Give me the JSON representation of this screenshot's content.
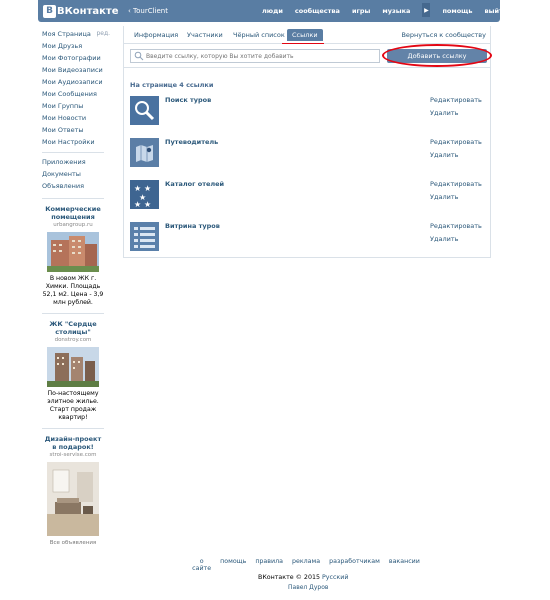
{
  "topbar": {
    "logo_text": "ВКонтакте",
    "logo_letter": "В",
    "back_label": "‹ TourClient",
    "nav": [
      "люди",
      "сообщества",
      "игры",
      "музыка",
      "помощь",
      "выйти"
    ],
    "colors": {
      "bar": "#597da3",
      "link": "#2b587a"
    }
  },
  "sidebar": {
    "edit_label": "ред.",
    "items": [
      "Моя Страница",
      "Мои Друзья",
      "Мои Фотографии",
      "Мои Видеозаписи",
      "Мои Аудиозаписи",
      "Мои Сообщения",
      "Мои Группы",
      "Мои Новости",
      "Мои Ответы",
      "Мои Настройки"
    ],
    "extra": [
      "Приложения",
      "Документы",
      "Объявления"
    ],
    "ads": [
      {
        "title": "Коммерческие помещения",
        "domain": "urbangroup.ru",
        "text": "В новом ЖК г. Химки. Площадь 52,1 м2. Цена - 3,9 млн рублей."
      },
      {
        "title": "ЖК \"Сердце столицы\"",
        "domain": "donstroy.com",
        "text": "По-настоящему элитное жилье. Старт продаж квартир!"
      },
      {
        "title": "Дизайн-проект в подарок!",
        "domain": "stroi-servise.com",
        "text": ""
      }
    ],
    "all_ads": "Все объявления"
  },
  "tabs": {
    "items": [
      "Информация",
      "Участники",
      "Чёрный список",
      "Ссылки"
    ],
    "active": "Ссылки",
    "return_label": "Вернуться к сообществу"
  },
  "search": {
    "placeholder": "Введите ссылку, которую Вы хотите добавить",
    "add_label": "Добавить ссылку"
  },
  "links": {
    "count_label": "На странице 4 ссылки",
    "edit_label": "Редактировать",
    "delete_label": "Удалить",
    "items": [
      {
        "title": "Поиск туров",
        "icon": "magnifier-icon"
      },
      {
        "title": "Путеводитель",
        "icon": "map-icon"
      },
      {
        "title": "Каталог отелей",
        "icon": "stars-icon"
      },
      {
        "title": "Витрина туров",
        "icon": "list-icon"
      }
    ]
  },
  "footer": {
    "links": [
      "о сайте",
      "помощь",
      "правила",
      "реклама",
      "разработчикам",
      "вакансии"
    ],
    "copyright": "ВКонтакте © 2015",
    "language": "Русский",
    "author": "Павел Дуров"
  }
}
